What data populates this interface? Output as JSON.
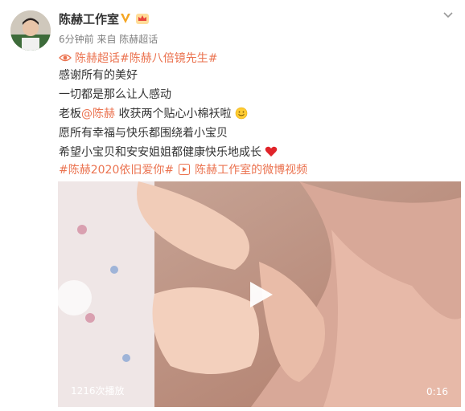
{
  "post": {
    "author": "陈赫工作室",
    "meta": "6分钟前 来自 陈赫超话",
    "topics_line": "陈赫超话#陈赫八倍镜先生#",
    "lines": [
      "感谢所有的美好",
      "一切都是那么让人感动"
    ],
    "line3_prefix": "老板",
    "line3_mention": "@陈赫",
    "line3_suffix": " 收获两个贴心小棉袄啦",
    "line4": "愿所有幸福与快乐都围绕着小宝贝",
    "line5": "希望小宝贝和安安姐姐都健康快乐地成长",
    "hashtag": "#陈赫2020依旧爱你#",
    "video_link": "陈赫工作室的微博视频"
  },
  "video": {
    "plays": "1216次播放",
    "duration": "0:16"
  },
  "icons": {
    "verified": "verified-v-icon",
    "member": "crown-icon",
    "more": "chevron-down-icon",
    "supertopic": "eye-icon",
    "video": "video-play-icon",
    "emoji": "smile-emoji-icon",
    "heart": "red-heart-emoji-icon"
  },
  "colors": {
    "link": "#eb7350",
    "text": "#333333",
    "meta": "#808080",
    "verified": "#f5a623"
  }
}
